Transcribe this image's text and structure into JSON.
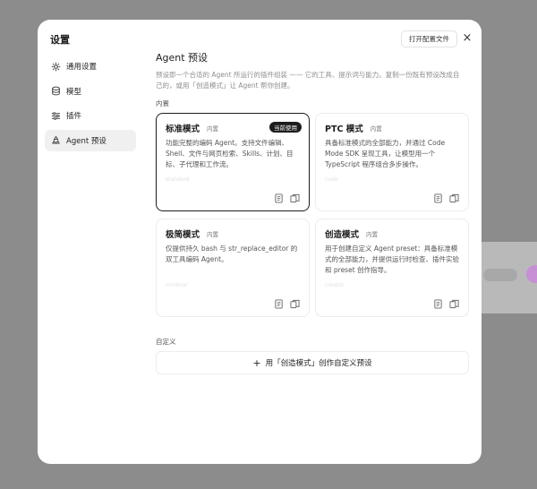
{
  "dialog": {
    "title": "设置",
    "open_config_label": "打开配置文件",
    "close_icon": "×"
  },
  "sidebar": {
    "items": [
      {
        "label": "通用设置",
        "icon": "gear-icon"
      },
      {
        "label": "模型",
        "icon": "database-icon"
      },
      {
        "label": "插件",
        "icon": "sliders-icon"
      },
      {
        "label": "Agent 预设",
        "icon": "recycle-icon",
        "active": true
      }
    ]
  },
  "main": {
    "title": "Agent 预设",
    "description": "预设即一个合适的 Agent 所运行的插件组装 —— 它的工具、提示词与能力。复制一份既有预设改成自己的，或用「创造模式」让 Agent 帮你创建。",
    "builtin_label": "内置",
    "custom_label": "自定义",
    "create_button_label": "用「创造模式」创作自定义预设",
    "create_button_icon": "+"
  },
  "cards": [
    {
      "name": "标准模式",
      "badge": "内置",
      "current": "当前使用",
      "desc": "功能完整的编码 Agent。支持文件编辑、Shell、文件与网页检索、Skills、计划、目标、子代理和工作流。",
      "ver": "standard"
    },
    {
      "name": "PTC 模式",
      "badge": "内置",
      "desc": "具备标准模式的全部能力，并通过 Code Mode SDK 呈现工具，让模型用一个 TypeScript 程序组合多步操作。",
      "ver": "code"
    },
    {
      "name": "极简模式",
      "badge": "内置",
      "desc": "仅提供持久 bash 与 str_replace_editor 的双工具编码 Agent。",
      "ver": "minimal"
    },
    {
      "name": "创造模式",
      "badge": "内置",
      "desc": "用于创建自定义 Agent preset：具备标准模式的全部能力，并提供运行时检查、插件实验和 preset 创作指导。",
      "ver": "creator"
    }
  ],
  "colors": {
    "accent": "#1d1d1f",
    "muted_text": "#8e8e93",
    "card_border": "#ececec"
  }
}
